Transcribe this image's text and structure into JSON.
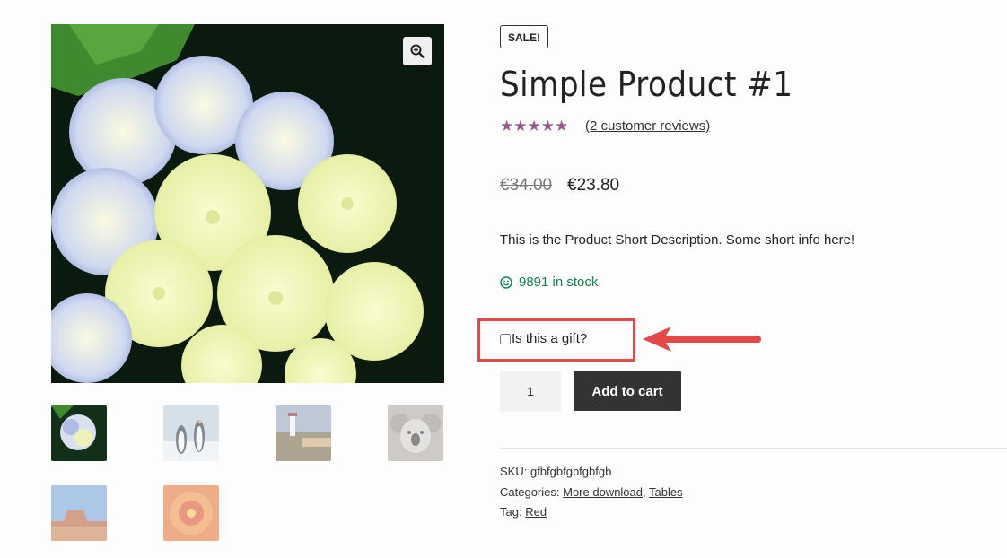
{
  "product": {
    "sale_badge": "SALE!",
    "title": "Simple Product #1",
    "rating": 5,
    "rating_max": 5,
    "reviews_link": "(2 customer reviews)",
    "price_old": "€34.00",
    "price_new": "€23.80",
    "short_description": "This is the Product Short Description. Some short info here!",
    "stock": "9891 in stock",
    "gift_label": "Is this a gift?",
    "gift_checked": false,
    "quantity": "1",
    "add_to_cart": "Add to cart"
  },
  "gallery": {
    "thumbnails": [
      "hydrangea",
      "penguins",
      "lighthouse",
      "koala",
      "desert",
      "chrysanthemum"
    ]
  },
  "meta": {
    "sku_label": "SKU:",
    "sku_value": "gfbfgbfgbfgbfgb",
    "categories_label": "Categories:",
    "categories": [
      "More download",
      "Tables"
    ],
    "tag_label": "Tag:",
    "tag": "Red"
  },
  "colors": {
    "star": "#96588a",
    "stock": "#0f834d",
    "highlight": "#e24a4a",
    "button": "#333333"
  },
  "icons": {
    "zoom": "zoom-in-icon",
    "stock": "smiley-icon",
    "annotation": "red-arrow"
  }
}
